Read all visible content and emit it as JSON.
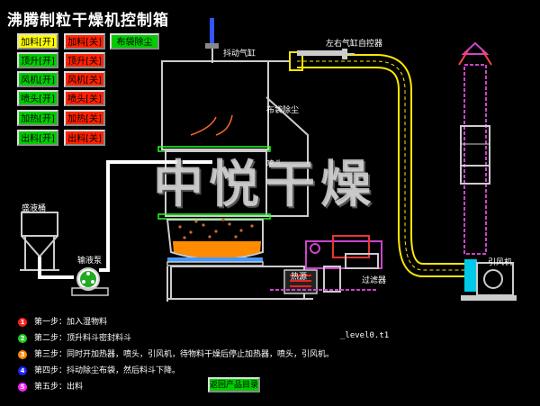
{
  "title": "沸腾制粒干燥机控制箱",
  "buttons": {
    "row1": {
      "on": "加料[开]",
      "off": "加料[关]",
      "extra": "布袋除尘"
    },
    "row2": {
      "on": "顶升[开]",
      "off": "顶升[关]"
    },
    "row3": {
      "on": "风机[开]",
      "off": "风机[关]"
    },
    "row4": {
      "on": "喷头[开]",
      "off": "喷头[关]"
    },
    "row5": {
      "on": "加热[开]",
      "off": "加热[关]"
    },
    "row6": {
      "on": "出料[开]",
      "off": "出料[关]"
    }
  },
  "labels": {
    "shake_cylinder": "抖动气缸",
    "cylinder_controller": "左右气缸自控器",
    "bag_filter": "布袋除尘",
    "nozzle": "喷头",
    "liquid_tank": "盛液桶",
    "pump": "输液泵",
    "heat_source": "热源",
    "filter": "过滤器",
    "fan": "引风机"
  },
  "watermark": "中悦干燥",
  "file_label": "_level0.t1",
  "steps": [
    {
      "num": "1",
      "color": "#ff2222",
      "text": "第一步：加入湿物料"
    },
    {
      "num": "2",
      "color": "#22cc22",
      "text": "第二步：顶升料斗密封料斗"
    },
    {
      "num": "3",
      "color": "#ff8800",
      "text": "第三步：同时开加热器，喷头，引风机，待物料干燥后停止加热器，喷头，引风机。"
    },
    {
      "num": "4",
      "color": "#2222ff",
      "text": "第四步：抖动除尘布袋，然后料斗下降。"
    },
    {
      "num": "5",
      "color": "#ff22ff",
      "text": "第五步：出料"
    }
  ],
  "back_button": "返回产品目录",
  "colors": {
    "pipe": "#ffff00",
    "frame": "#cccccc",
    "fan_pipe": "#cc44cc",
    "liquid": "#ff8800"
  }
}
